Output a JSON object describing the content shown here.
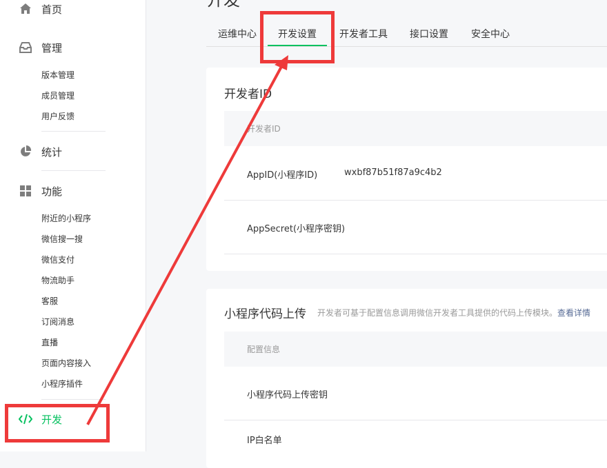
{
  "sidebar": {
    "home": "首页",
    "manage": "管理",
    "manage_items": [
      "版本管理",
      "成员管理",
      "用户反馈"
    ],
    "stats": "统计",
    "features": "功能",
    "feature_items": [
      "附近的小程序",
      "微信搜一搜",
      "微信支付",
      "物流助手",
      "客服",
      "订阅消息",
      "直播",
      "页面内容接入",
      "小程序插件"
    ],
    "develop": "开发"
  },
  "page": {
    "title": "开发"
  },
  "tabs": [
    "运维中心",
    "开发设置",
    "开发者工具",
    "接口设置",
    "安全中心"
  ],
  "developer_id": {
    "title": "开发者ID",
    "table_header": "开发者ID",
    "rows": [
      {
        "key": "AppID(小程序ID)",
        "value": "wxbf87b51f87a9c4b2"
      },
      {
        "key": "AppSecret(小程序密钥)",
        "value": ""
      }
    ]
  },
  "code_upload": {
    "title": "小程序代码上传",
    "desc": "开发者可基于配置信息调用微信开发者工具提供的代码上传模块。",
    "link": "查看详情",
    "table_header": "配置信息",
    "rows": [
      {
        "key": "小程序代码上传密钥"
      },
      {
        "key": "IP白名单"
      }
    ]
  },
  "colors": {
    "accent": "#07c160",
    "annotation": "#ee3a3a",
    "link": "#576b95"
  }
}
